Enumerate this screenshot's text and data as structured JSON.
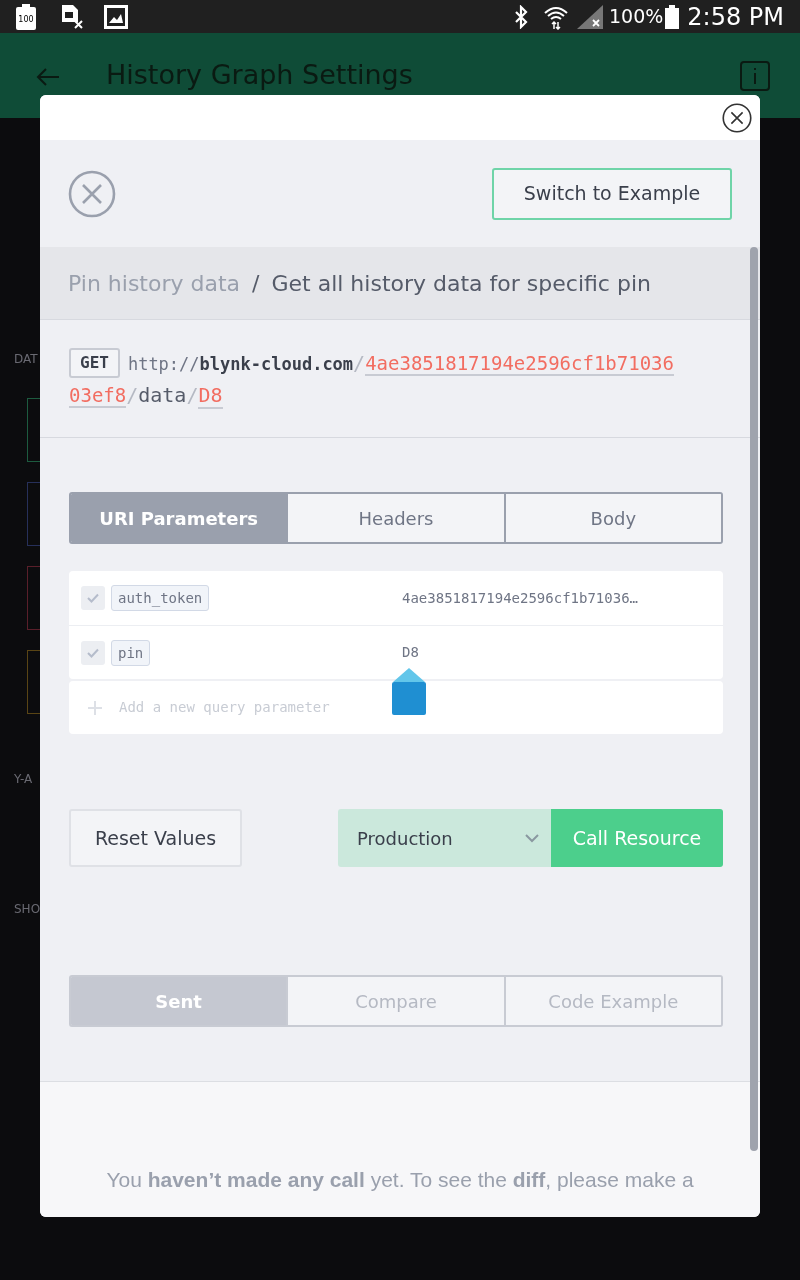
{
  "status_bar": {
    "battery_badge": "100",
    "battery": "100%",
    "time": "2:58 PM"
  },
  "app_bar": {
    "title": "History Graph Settings"
  },
  "background": {
    "labels": [
      "DAT",
      "Y-A",
      "SHO"
    ],
    "cards": [
      {
        "color": "#1d5b3f"
      },
      {
        "color": "#27305a"
      },
      {
        "color": "#5a1f2a"
      },
      {
        "color": "#5a4515"
      }
    ]
  },
  "dialog": {
    "switch_button": "Switch to Example",
    "breadcrumb": {
      "section": "Pin history data",
      "separator": "/",
      "title": "Get all history data for specific pin"
    },
    "request": {
      "method": "GET",
      "scheme": "http://",
      "host": "blynk-cloud.com",
      "sep1": "/",
      "token_part1": "4ae3851817194e2596cf1b71036",
      "token_part2": "03ef8",
      "sep2": "/",
      "path": "data",
      "sep3": "/",
      "pin": "D8"
    },
    "tabs": [
      {
        "label": "URI Parameters",
        "selected": true
      },
      {
        "label": "Headers",
        "selected": false
      },
      {
        "label": "Body",
        "selected": false
      }
    ],
    "parameters": [
      {
        "name": "auth_token",
        "value": "4ae3851817194e2596cf1b71036…",
        "checked": true
      },
      {
        "name": "pin",
        "value": "D8",
        "checked": true
      }
    ],
    "add_parameter": {
      "placeholder": "Add a new query parameter"
    },
    "reset_button": "Reset Values",
    "environment": "Production",
    "call_button": "Call Resource",
    "result_tabs": [
      {
        "label": "Sent",
        "selected": true
      },
      {
        "label": "Compare",
        "selected": false
      },
      {
        "label": "Code Example",
        "selected": false
      }
    ],
    "message": "You **haven’t made any call** yet. To see the **diff**, please make a"
  }
}
